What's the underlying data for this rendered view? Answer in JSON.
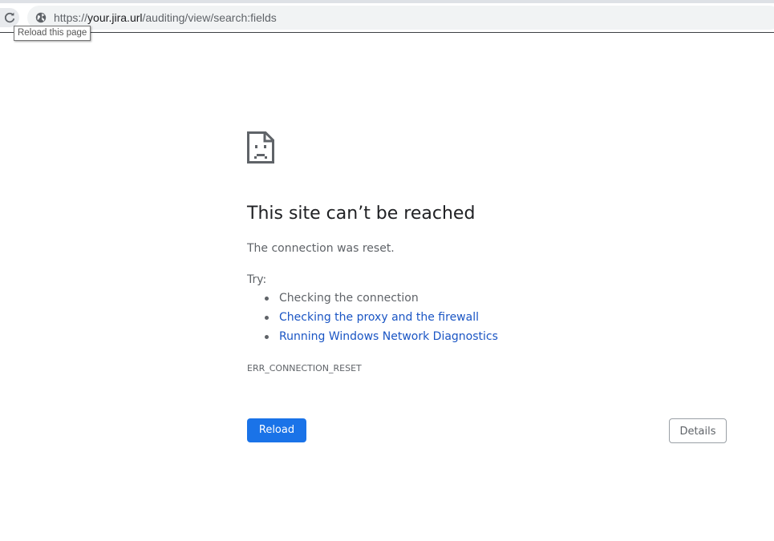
{
  "browser": {
    "url": {
      "scheme": "https://",
      "host": "your.jira.url",
      "path": "/auditing/view/search:fields"
    },
    "reload_tooltip": "Reload this page",
    "icons": {
      "reload": "reload-icon",
      "site_info": "globe-icon"
    }
  },
  "error_page": {
    "icon": "sad-document-icon",
    "title": "This site can’t be reached",
    "message": "The connection was reset.",
    "try_label": "Try:",
    "suggestions": [
      {
        "text": "Checking the connection",
        "is_link": false
      },
      {
        "text": "Checking the proxy and the firewall",
        "is_link": true
      },
      {
        "text": "Running Windows Network Diagnostics",
        "is_link": true
      }
    ],
    "error_code": "ERR_CONNECTION_RESET",
    "buttons": {
      "reload": "Reload",
      "details": "Details"
    }
  },
  "colors": {
    "primary_button": "#1a73e8",
    "link": "#1a55c4",
    "heading": "#202124",
    "body_text": "#5f6368"
  }
}
